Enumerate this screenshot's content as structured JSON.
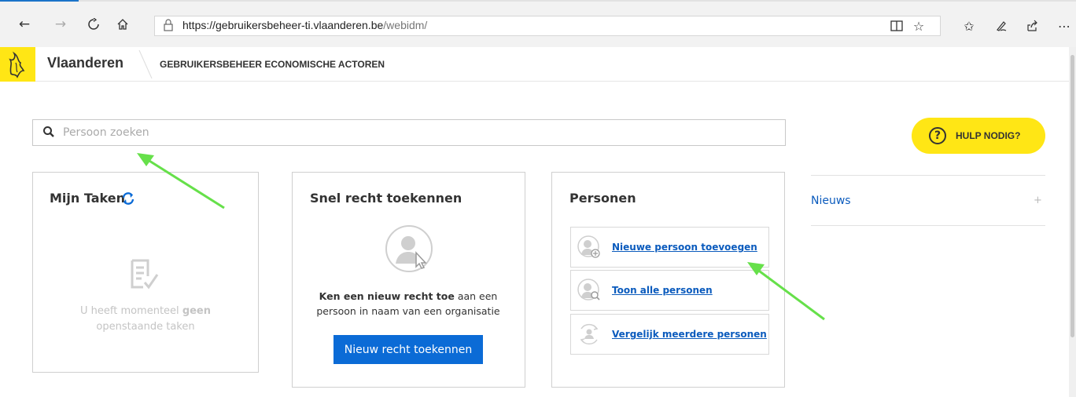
{
  "browser": {
    "url_host": "https://gebruikersbeheer-ti.vlaanderen.be",
    "url_path": "/webidm/",
    "icons": [
      "back-icon",
      "forward-icon",
      "refresh-icon",
      "home-icon",
      "reading-view-icon",
      "favorite-star-icon",
      "favorites-list-icon",
      "pen-icon",
      "share-icon",
      "more-icon"
    ]
  },
  "header": {
    "brand": "Vlaanderen",
    "app_title": "GEBRUIKERSBEHEER ECONOMISCHE ACTOREN"
  },
  "search": {
    "placeholder": "Persoon zoeken",
    "value": ""
  },
  "help": {
    "label": "HULP NODIG?",
    "symbol": "?"
  },
  "tasks": {
    "title": "Mijn Taken",
    "empty_pre": "U heeft momenteel ",
    "empty_bold": "geen",
    "empty_post": " openstaande taken"
  },
  "assign": {
    "title": "Snel recht toekennen",
    "desc_bold": "Ken een nieuw recht toe",
    "desc_rest": " aan een persoon in naam van een organisatie",
    "button": "Nieuw recht toekennen"
  },
  "persons": {
    "title": "Personen",
    "items": [
      {
        "label": "Nieuwe persoon toevoegen"
      },
      {
        "label": "Toon alle personen"
      },
      {
        "label": "Vergelijk meerdere personen"
      }
    ]
  },
  "news": {
    "label": "Nieuws",
    "toggle": "+"
  },
  "colors": {
    "brand_yellow": "#ffe615",
    "primary_blue": "#0b6bd6",
    "link_blue": "#0b5bbd",
    "annotation_green": "#66e04a"
  }
}
